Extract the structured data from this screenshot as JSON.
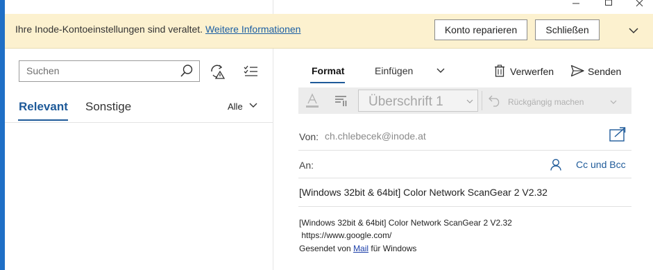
{
  "window": {
    "minimize_icon": "minimize-icon",
    "maximize_icon": "maximize-icon",
    "close_icon": "close-icon"
  },
  "banner": {
    "message": "Ihre Inode-Kontoeinstellungen sind veraltet.",
    "link": "Weitere Informationen",
    "repair_button": "Konto reparieren",
    "close_button": "Schließen",
    "bg_color": "#fcf1cf"
  },
  "left_pane": {
    "search_placeholder": "Suchen",
    "tabs": [
      {
        "label": "Relevant",
        "active": true
      },
      {
        "label": "Sonstige",
        "active": false
      }
    ],
    "filter": "Alle",
    "accent_color": "#1e5a99"
  },
  "compose": {
    "ribbon_tabs": [
      {
        "label": "Format",
        "active": true
      },
      {
        "label": "Einfügen",
        "active": false
      }
    ],
    "discard_label": "Verwerfen",
    "send_label": "Senden",
    "toolbar": {
      "style_value": "Überschrift 1",
      "undo_label": "Rückgängig machen"
    },
    "from_label": "Von:",
    "from_value": "ch.chlebecek@inode.at",
    "to_label": "An:",
    "cc_bcc": "Cc und Bcc",
    "subject": "[Windows 32bit & 64bit] Color Network ScanGear 2 V2.32",
    "body": {
      "line1": "[Windows 32bit & 64bit] Color Network ScanGear 2 V2.32",
      "line2": " https://www.google.com/",
      "signature_prefix": "Gesendet von ",
      "signature_link": "Mail",
      "signature_suffix": " für Windows"
    }
  }
}
